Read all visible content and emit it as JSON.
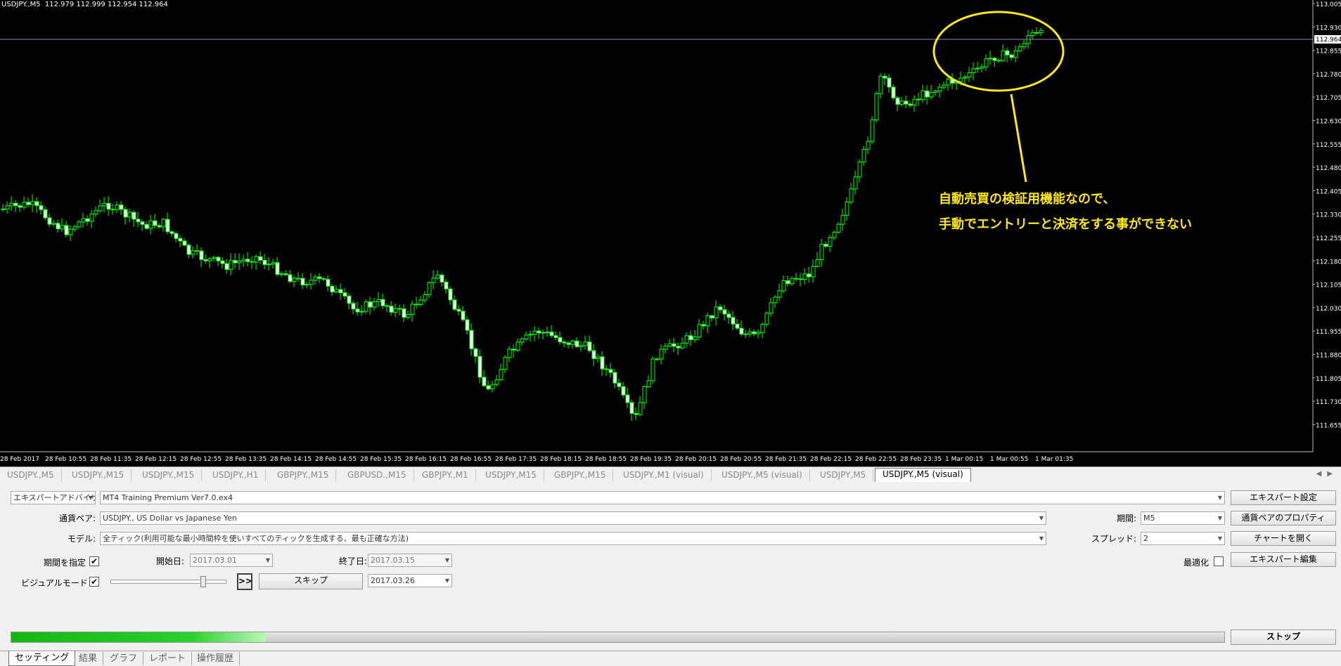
{
  "chart": {
    "symbol_line": "USDJPY.,M5  112.979 112.999 112.954 112.964",
    "current_price": "112.964",
    "price_axis": [
      "113.005",
      "112.930",
      "112.855",
      "112.780",
      "112.705",
      "112.630",
      "112.555",
      "112.480",
      "112.405",
      "112.330",
      "112.255",
      "112.180",
      "112.105",
      "112.030",
      "111.955",
      "111.880",
      "111.805",
      "111.730",
      "111.655"
    ],
    "time_axis": [
      "28 Feb 2017",
      "28 Feb 10:55",
      "28 Feb 11:35",
      "28 Feb 12:15",
      "28 Feb 12:55",
      "28 Feb 13:35",
      "28 Feb 14:15",
      "28 Feb 14:55",
      "28 Feb 15:35",
      "28 Feb 16:15",
      "28 Feb 16:55",
      "28 Feb 17:35",
      "28 Feb 18:15",
      "28 Feb 18:55",
      "28 Feb 19:35",
      "28 Feb 20:15",
      "28 Feb 20:55",
      "28 Feb 21:35",
      "28 Feb 22:15",
      "28 Feb 22:55",
      "28 Feb 23:35",
      "1 Mar 00:15",
      "1 Mar 00:55",
      "1 Mar 01:35"
    ],
    "annotation_line1": "自動売買の検証用機能なので、",
    "annotation_line2": "手動でエントリーと決済をする事ができない",
    "colors": {
      "background": "#000000",
      "candle": "#00ff00",
      "annotation": "#ffe81a",
      "bid_line": "#8090b0"
    }
  },
  "chart_tabs": [
    {
      "label": "USDJPY.,M5",
      "active": false
    },
    {
      "label": "USDJPY.,M15",
      "active": false
    },
    {
      "label": "USDJPY.,M15",
      "active": false
    },
    {
      "label": "USDJPY.,H1",
      "active": false
    },
    {
      "label": "GBPJPY.,M15",
      "active": false
    },
    {
      "label": "GBPUSD.,M15",
      "active": false
    },
    {
      "label": "GBPJPY.,M1",
      "active": false
    },
    {
      "label": "USDJPY,M15",
      "active": false
    },
    {
      "label": "GBPJPY.,M15",
      "active": false
    },
    {
      "label": "USDJPY.,M1 (visual)",
      "active": false
    },
    {
      "label": "USDJPY.,M5 (visual)",
      "active": false
    },
    {
      "label": "USDJPY,M5",
      "active": false
    },
    {
      "label": "USDJPY.,M5 (visual)",
      "active": true
    }
  ],
  "tester": {
    "type_select": "エキスパートアドバイザ",
    "expert_select": "MT4 Training Premium Ver7.0.ex4",
    "expert_settings_btn": "エキスパート設定",
    "symbol_label": "通貨ペア:",
    "symbol_value": "USDJPY., US Dollar vs Japanese Yen",
    "period_label": "期間:",
    "period_value": "M5",
    "symbol_props_btn": "通貨ペアのプロパティ",
    "model_label": "モデル:",
    "model_value": "全ティック(利用可能な最小時間枠を使いすべてのティックを生成する、最も正確な方法)",
    "spread_label": "スプレッド:",
    "spread_value": "2",
    "open_chart_btn": "チャートを開く",
    "use_date_label": "期間を指定",
    "use_date_checked": "✔",
    "from_label": "開始日:",
    "from_value": "2017.03.01",
    "to_label": "終了日:",
    "to_value": "2017.03.15",
    "optimize_label": "最適化",
    "edit_expert_btn": "エキスパート編集",
    "visual_label": "ビジュアルモード",
    "visual_checked": "✔",
    "skip_arrow": ">>",
    "skip_btn": "スキップ",
    "skip_date": "2017.03.26",
    "stop_btn": "ストップ",
    "progress_fraction": 0.21,
    "visual_speed_fraction": 0.8
  },
  "bottom_tabs": [
    {
      "label": "セッティング",
      "active": true
    },
    {
      "label": "結果",
      "active": false
    },
    {
      "label": "グラフ",
      "active": false
    },
    {
      "label": "レポート",
      "active": false
    },
    {
      "label": "操作履歴",
      "active": false
    }
  ]
}
